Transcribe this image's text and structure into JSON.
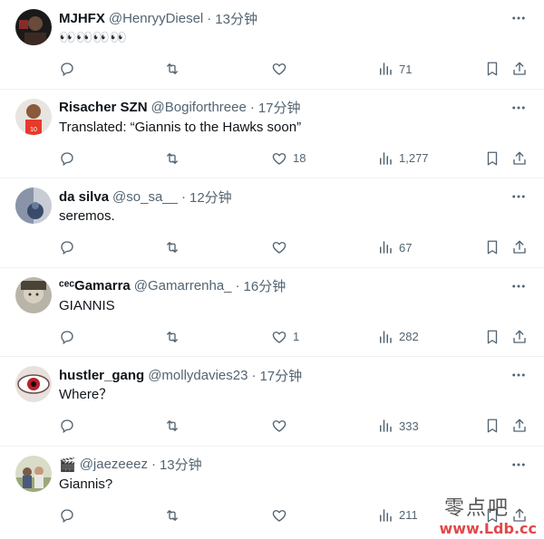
{
  "colors": {
    "text_primary": "#0f1419",
    "text_secondary": "#536471",
    "divider": "#eff3f4",
    "watermark_red": "#e0484b"
  },
  "actions": {
    "reply_icon": "reply-icon",
    "retweet_icon": "retweet-icon",
    "like_icon": "heart-icon",
    "views_icon": "views-chart-icon",
    "bookmark_icon": "bookmark-icon",
    "share_icon": "share-icon"
  },
  "tweets": [
    {
      "name": "MJHFX",
      "handle": "@HenryyDiesel",
      "separator": "·",
      "time": "13分钟",
      "text": "👀👀👀👀",
      "likes": "",
      "views": "71"
    },
    {
      "name": "Risacher SZN",
      "handle": "@Bogiforthreee",
      "separator": "·",
      "time": "17分钟",
      "text": "Translated: “Giannis to the Hawks soon”",
      "likes": "18",
      "views": "1,277"
    },
    {
      "name": "da silva",
      "handle": "@so_sa__",
      "separator": "·",
      "time": "12分钟",
      "text": "seremos.",
      "likes": "",
      "views": "67"
    },
    {
      "name": "ᶜᵉᶜGamarra",
      "handle": "@Gamarrenha_",
      "separator": "·",
      "time": "16分钟",
      "text": "GIANNIS",
      "likes": "1",
      "views": "282"
    },
    {
      "name": "hustler_gang",
      "handle": "@mollydavies23",
      "separator": "·",
      "time": "17分钟",
      "text": "Where？",
      "likes": "",
      "views": "333"
    },
    {
      "name": "🎬",
      "handle": "@jaezeeez",
      "separator": "·",
      "time": "13分钟",
      "text": "Giannis?",
      "likes": "",
      "views": "211"
    }
  ],
  "watermark": {
    "line1": "零点吧",
    "line2": "www.Ldb.cc"
  }
}
